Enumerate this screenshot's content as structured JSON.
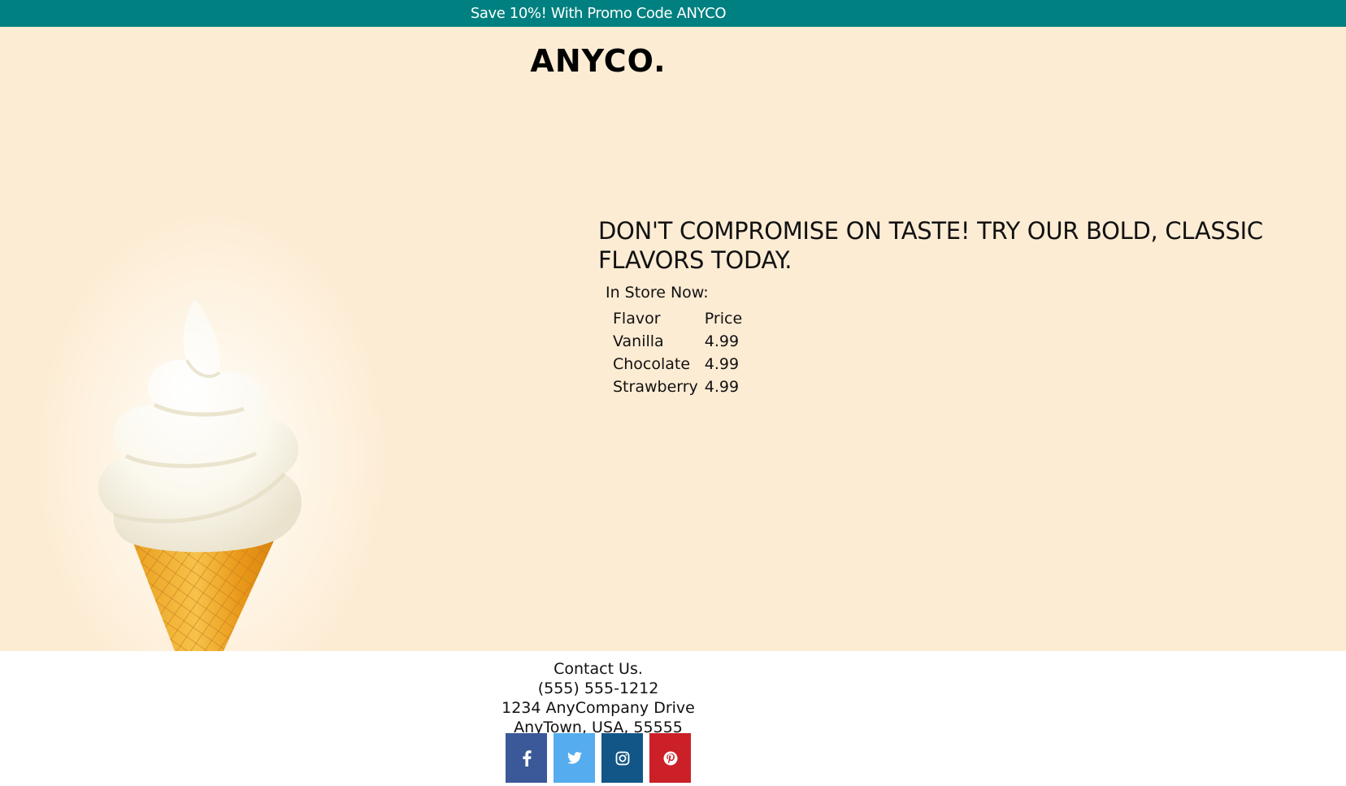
{
  "promo": {
    "text": "Save 10%! With Promo Code ANYCO",
    "background": "#008080"
  },
  "header": {
    "logo": "ANYCO."
  },
  "hero": {
    "background": "#fdecd4",
    "image": "ice-cream-cone",
    "headline": "DON'T COMPROMISE ON TASTE! TRY OUR BOLD, CLASSIC FLAVORS TODAY.",
    "store_label": "In Store Now:",
    "table": {
      "headers": [
        "Flavor",
        "Price"
      ],
      "rows": [
        [
          "Vanilla",
          "4.99"
        ],
        [
          "Chocolate",
          "4.99"
        ],
        [
          "Strawberry",
          "4.99"
        ]
      ]
    }
  },
  "footer": {
    "contact_title": "Contact Us.",
    "phone": "(555) 555-1212",
    "address_line1": "1234 AnyCompany Drive",
    "address_line2": "AnyTown, USA, 55555",
    "social": [
      {
        "name": "facebook-icon",
        "color": "#3b5998"
      },
      {
        "name": "twitter-icon",
        "color": "#55acee"
      },
      {
        "name": "instagram-icon",
        "color": "#125688"
      },
      {
        "name": "pinterest-icon",
        "color": "#cb2027"
      }
    ]
  }
}
